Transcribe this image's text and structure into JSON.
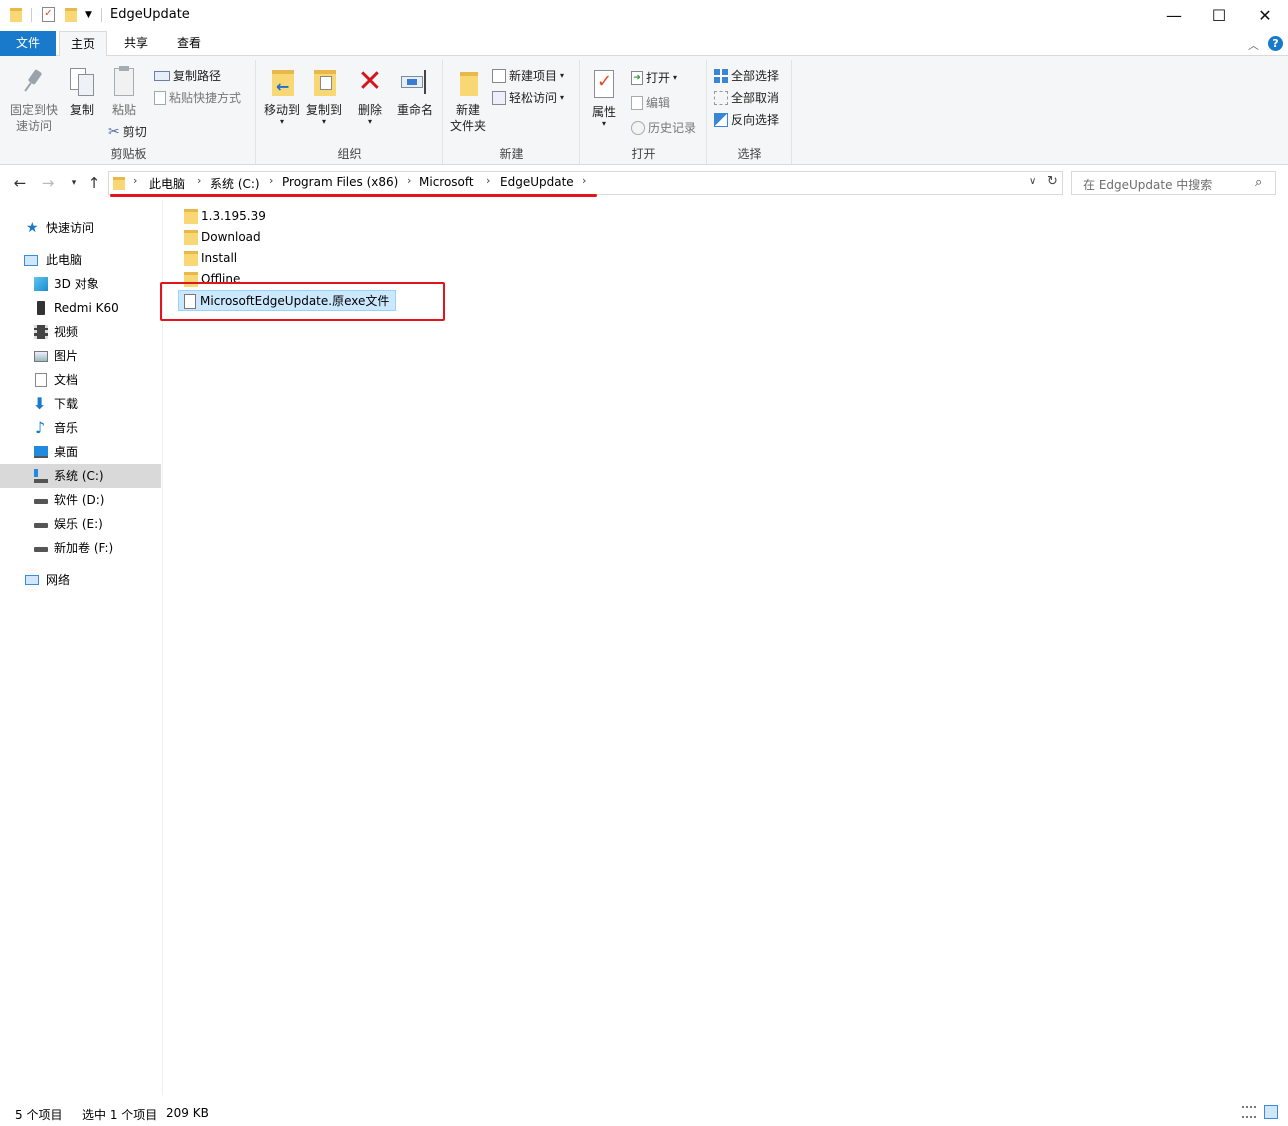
{
  "window": {
    "title": "EdgeUpdate",
    "minimize_glyph": "—",
    "maximize_glyph": "☐",
    "close_glyph": "✕"
  },
  "tabs": [
    {
      "label": "文件"
    },
    {
      "label": "主页"
    },
    {
      "label": "共享"
    },
    {
      "label": "查看"
    }
  ],
  "ribbon": {
    "clipboard": {
      "pin_label_1": "固定到快",
      "pin_label_2": "速访问",
      "copy_label": "复制",
      "paste_label": "粘贴",
      "copy_path": "复制路径",
      "paste_shortcut": "粘贴快捷方式",
      "cut": "剪切",
      "group_label": "剪贴板"
    },
    "organize": {
      "move_to": "移动到",
      "copy_to": "复制到",
      "delete": "删除",
      "rename": "重命名",
      "group_label": "组织"
    },
    "new": {
      "new_folder_1": "新建",
      "new_folder_2": "文件夹",
      "new_item": "新建项目",
      "easy_access": "轻松访问",
      "group_label": "新建"
    },
    "open": {
      "properties": "属性",
      "open": "打开",
      "edit": "编辑",
      "history": "历史记录",
      "group_label": "打开"
    },
    "select": {
      "select_all": "全部选择",
      "select_none": "全部取消",
      "invert": "反向选择",
      "group_label": "选择"
    }
  },
  "address": {
    "crumbs": [
      "此电脑",
      "系统 (C:)",
      "Program Files (x86)",
      "Microsoft",
      "EdgeUpdate"
    ],
    "search_placeholder": "在 EdgeUpdate 中搜索"
  },
  "nav": {
    "quick_access": "快速访问",
    "this_pc": "此电脑",
    "items": [
      {
        "label": "3D 对象"
      },
      {
        "label": "Redmi K60"
      },
      {
        "label": "视频"
      },
      {
        "label": "图片"
      },
      {
        "label": "文档"
      },
      {
        "label": "下载"
      },
      {
        "label": "音乐"
      },
      {
        "label": "桌面"
      },
      {
        "label": "系统 (C:)"
      },
      {
        "label": "软件 (D:)"
      },
      {
        "label": "娱乐 (E:)"
      },
      {
        "label": "新加卷 (F:)"
      }
    ],
    "network": "网络"
  },
  "files": [
    {
      "name": "1.3.195.39",
      "type": "folder"
    },
    {
      "name": "Download",
      "type": "folder"
    },
    {
      "name": "Install",
      "type": "folder"
    },
    {
      "name": "Offline",
      "type": "folder"
    },
    {
      "name": "MicrosoftEdgeUpdate.原exe文件",
      "type": "file",
      "selected": true
    }
  ],
  "status": {
    "item_count": "5 个项目",
    "selection": "选中 1 个项目",
    "size": "209 KB"
  },
  "colors": {
    "accent": "#1979ca",
    "annotation_red": "#e3141c",
    "folder": "#f8d775",
    "selection": "#cce8ff"
  }
}
